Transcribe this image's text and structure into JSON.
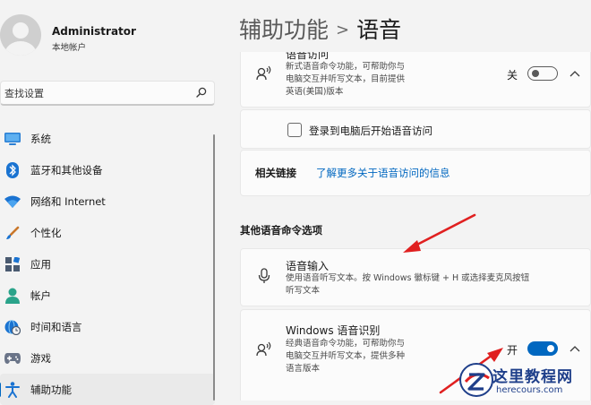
{
  "user": {
    "name": "Administrator",
    "account_type": "本地帐户"
  },
  "search": {
    "placeholder": "查找设置"
  },
  "sidebar": {
    "items": [
      {
        "label": "系统",
        "icon": "monitor-icon"
      },
      {
        "label": "蓝牙和其他设备",
        "icon": "bluetooth-icon"
      },
      {
        "label": "网络和 Internet",
        "icon": "wifi-icon"
      },
      {
        "label": "个性化",
        "icon": "brush-icon"
      },
      {
        "label": "应用",
        "icon": "apps-icon"
      },
      {
        "label": "帐户",
        "icon": "person-icon"
      },
      {
        "label": "时间和语言",
        "icon": "globe-clock-icon"
      },
      {
        "label": "游戏",
        "icon": "gamepad-icon"
      },
      {
        "label": "辅助功能",
        "icon": "accessibility-icon",
        "active": true
      }
    ]
  },
  "header": {
    "parent": "辅助功能",
    "current": "语音"
  },
  "voice_access": {
    "title_partial": "语音访问",
    "desc_line1": "新式语音命令功能，可帮助你与",
    "desc_line2": "电脑交互并听写文本，目前提供",
    "desc_line3": "英语(美国)版本",
    "toggle_label": "关",
    "toggle_on": false
  },
  "start_after_login": {
    "label": "登录到电脑后开始语音访问",
    "checked": false
  },
  "related_links": {
    "title": "相关链接",
    "link": "了解更多关于语音访问的信息"
  },
  "other_section": {
    "heading": "其他语音命令选项"
  },
  "voice_typing": {
    "title": "语音输入",
    "desc_line1": "使用语音听写文本。按 Windows 徽标键 + H 或选择麦克风按钮",
    "desc_line2": "听写文本"
  },
  "windows_speech": {
    "title": "Windows 语音识别",
    "desc_line1": "经典语音命令功能，可帮助你与",
    "desc_line2": "电脑交互并听写文本，提供多种",
    "desc_line3": "语言版本",
    "toggle_label": "开",
    "toggle_on": true
  },
  "watermark": {
    "title": "这里教程网",
    "url": "herecours.com"
  },
  "colors": {
    "accent": "#0067c0",
    "arrow": "#e02020"
  }
}
